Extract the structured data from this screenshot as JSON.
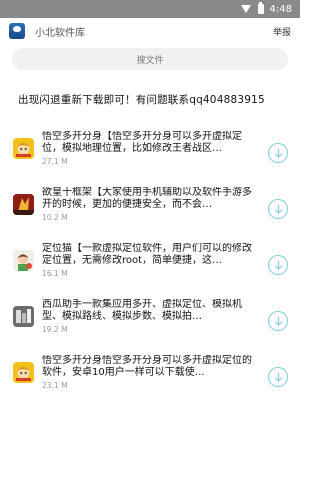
{
  "status": {
    "time": "4:48"
  },
  "appbar": {
    "title": "小北软件库",
    "feedback": "举报"
  },
  "search": {
    "placeholder": "搜文件"
  },
  "notice": "出现闪退重新下载即可！有问题联系qq404883915",
  "items": [
    {
      "name": "悟空多开分身【悟空多开分身可以多开虚拟定位，模拟地理位置，比如修改王者战区…",
      "size": "27.1 M",
      "icon": "wukong-app-icon"
    },
    {
      "name": "欲皇十框架【大家使用手机辅助以及软件手游多开的时候，更加的便捷安全，而不会…",
      "size": "10.2 M",
      "icon": "yuhuang-app-icon"
    },
    {
      "name": "定位猫【一款虚拟定位软件，用户们可以的修改定位置，无需修改root，简单便捷，这…",
      "size": "16.1 M",
      "icon": "dingweimao-app-icon"
    },
    {
      "name": "西瓜助手一款集应用多开、虚拟定位、模拟机型、模拟路线、模拟步数、模拟拍…",
      "size": "19.2 M",
      "icon": "xigua-app-icon"
    },
    {
      "name": "悟空多开分身悟空多开分身可以多开虚拟定位的软件，安卓10用户一样可以下载使…",
      "size": "23.1 M",
      "icon": "wukong-app-icon"
    }
  ],
  "colors": {
    "accent": "#7fd0e6",
    "statusbar": "#8a8a8a"
  }
}
